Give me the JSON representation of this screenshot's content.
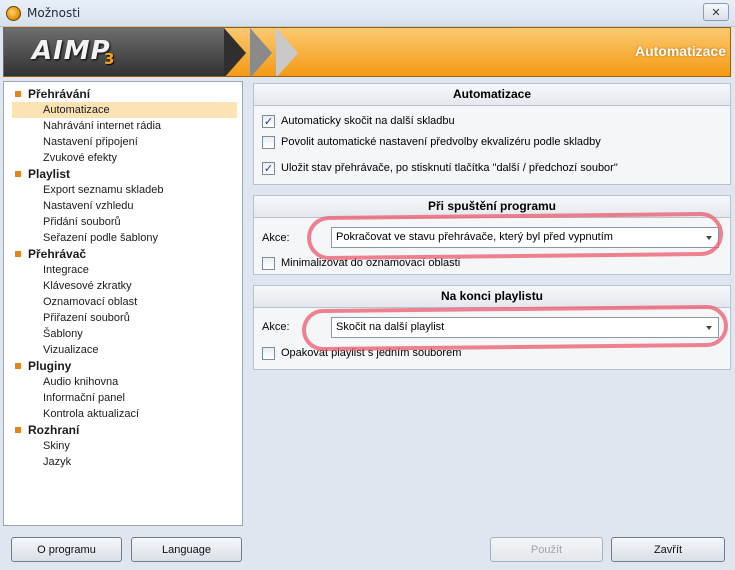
{
  "window": {
    "title": "Možnosti",
    "close_glyph": "✕"
  },
  "banner": {
    "logo": "AIMP",
    "logo_version": "3",
    "page_title": "Automatizace"
  },
  "tree": {
    "groups": [
      {
        "label": "Přehrávání",
        "items": [
          "Automatizace",
          "Nahrávání internet rádia",
          "Nastavení připojení",
          "Zvukové efekty"
        ]
      },
      {
        "label": "Playlist",
        "items": [
          "Export seznamu skladeb",
          "Nastavení vzhledu",
          "Přidání souborů",
          "Seřazení podle šablony"
        ]
      },
      {
        "label": "Přehrávač",
        "items": [
          "Integrace",
          "Klávesové zkratky",
          "Oznamovací oblast",
          "Přiřazení souborů",
          "Šablony",
          "Vizualizace"
        ]
      },
      {
        "label": "Pluginy",
        "items": [
          "Audio knihovna",
          "Informační panel",
          "Kontrola aktualizací"
        ]
      },
      {
        "label": "Rozhraní",
        "items": [
          "Skiny",
          "Jazyk"
        ]
      }
    ],
    "selected": "Automatizace"
  },
  "automation": {
    "heading": "Automatizace",
    "options": [
      {
        "label": "Automaticky skočit na další skladbu",
        "checked": true
      },
      {
        "label": "Povolit automatické nastavení předvolby ekvalizéru podle skladby",
        "checked": false
      },
      {
        "label": "Uložit stav přehrávače, po stisknutí tlačítka \"další / předchozí soubor\"",
        "checked": true
      }
    ]
  },
  "on_start": {
    "heading": "Při spuštění programu",
    "action_label": "Akce:",
    "action_value": "Pokračovat ve stavu přehrávače, který byl před vypnutím",
    "minimize_label": "Minimalizovat do oznamovací oblasti",
    "minimize_checked": false
  },
  "on_end": {
    "heading": "Na konci playlistu",
    "action_label": "Akce:",
    "action_value": "Skočit na další playlist",
    "repeat_label": "Opakovat playlist s jedním souborem",
    "repeat_checked": false
  },
  "buttons": {
    "about": "O programu",
    "language": "Language",
    "apply": "Použít",
    "close": "Zavřít"
  },
  "icons": {
    "check": "✓",
    "dropdown": "chevron-down-icon"
  },
  "colors": {
    "accent": "#f59a14",
    "tree_marker": "#e8831c",
    "selection": "#fbe3b4",
    "annotation": "#ec5a6e"
  }
}
